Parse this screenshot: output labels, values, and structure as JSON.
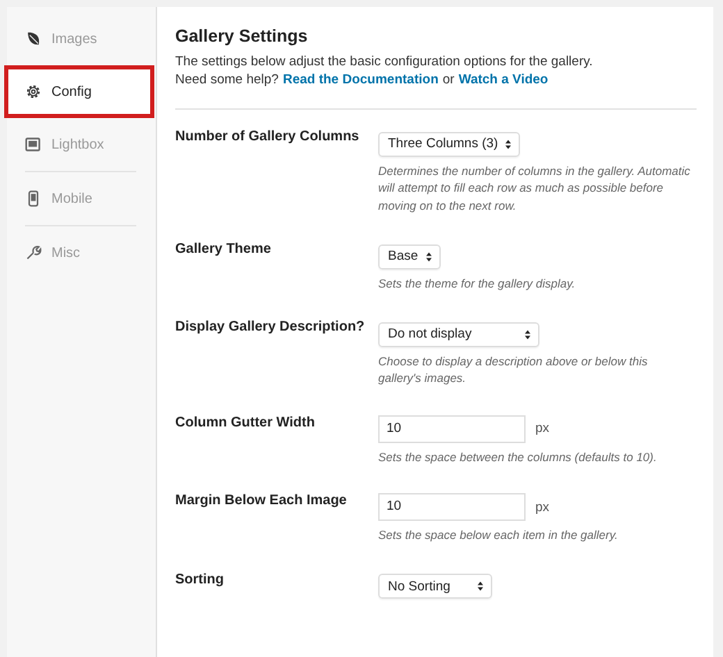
{
  "sidebar": {
    "items": [
      {
        "label": "Images",
        "selected": false
      },
      {
        "label": "Config",
        "selected": true
      },
      {
        "label": "Lightbox",
        "selected": false
      },
      {
        "label": "Mobile",
        "selected": false
      },
      {
        "label": "Misc",
        "selected": false
      }
    ]
  },
  "header": {
    "title": "Gallery Settings",
    "description": "The settings below adjust the basic configuration options for the gallery.",
    "help_text": "Need some help?",
    "links": [
      "Read the Documentation",
      "Watch a Video"
    ],
    "link_joiner": "or"
  },
  "settings": [
    {
      "label": "Number of Gallery Columns",
      "kind": "select",
      "value": "Three Columns (3)",
      "help": "Determines the number of columns in the gallery. Automatic will attempt to fill each row as much as possible before moving on to the next row."
    },
    {
      "label": "Gallery Theme",
      "kind": "select",
      "value": "Base",
      "help": "Sets the theme for the gallery display."
    },
    {
      "label": "Display Gallery Description?",
      "kind": "select",
      "value": "Do not display",
      "help": "Choose to display a description above or below this gallery's images."
    },
    {
      "label": "Column Gutter Width",
      "kind": "number",
      "value": "10",
      "unit": "px",
      "help": "Sets the space between the columns (defaults to 10)."
    },
    {
      "label": "Margin Below Each Image",
      "kind": "number",
      "value": "10",
      "unit": "px",
      "help": "Sets the space below each item in the gallery."
    },
    {
      "label": "Sorting",
      "kind": "select",
      "value": "No Sorting"
    }
  ]
}
